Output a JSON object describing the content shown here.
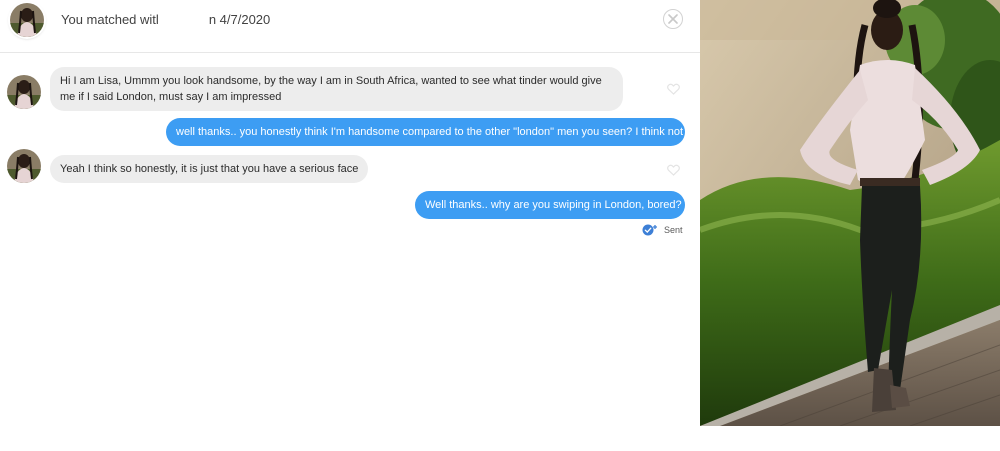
{
  "header": {
    "match_text_before": "You matched witl",
    "match_text_after": "n 4/7/2020"
  },
  "messages": [
    {
      "from": "received",
      "text": "Hi I am Lisa, Ummm you look handsome, by the way I am in South Africa, wanted to see what tinder would give me if I said London, must say I am impressed"
    },
    {
      "from": "sent",
      "text": "well thanks.. you honestly think I'm handsome compared to the other \"london\" men you seen? I think not"
    },
    {
      "from": "received",
      "text": "Yeah I think so honestly, it is just that you have a serious face"
    },
    {
      "from": "sent",
      "text": "Well thanks.. why are you swiping in London, bored?"
    }
  ],
  "status": {
    "label": "Sent"
  },
  "colors": {
    "sent_bubble": "#3d9df3",
    "received_bubble": "#ededed"
  },
  "icons": [
    "close-icon",
    "heart-icon",
    "sent-check-icon"
  ]
}
